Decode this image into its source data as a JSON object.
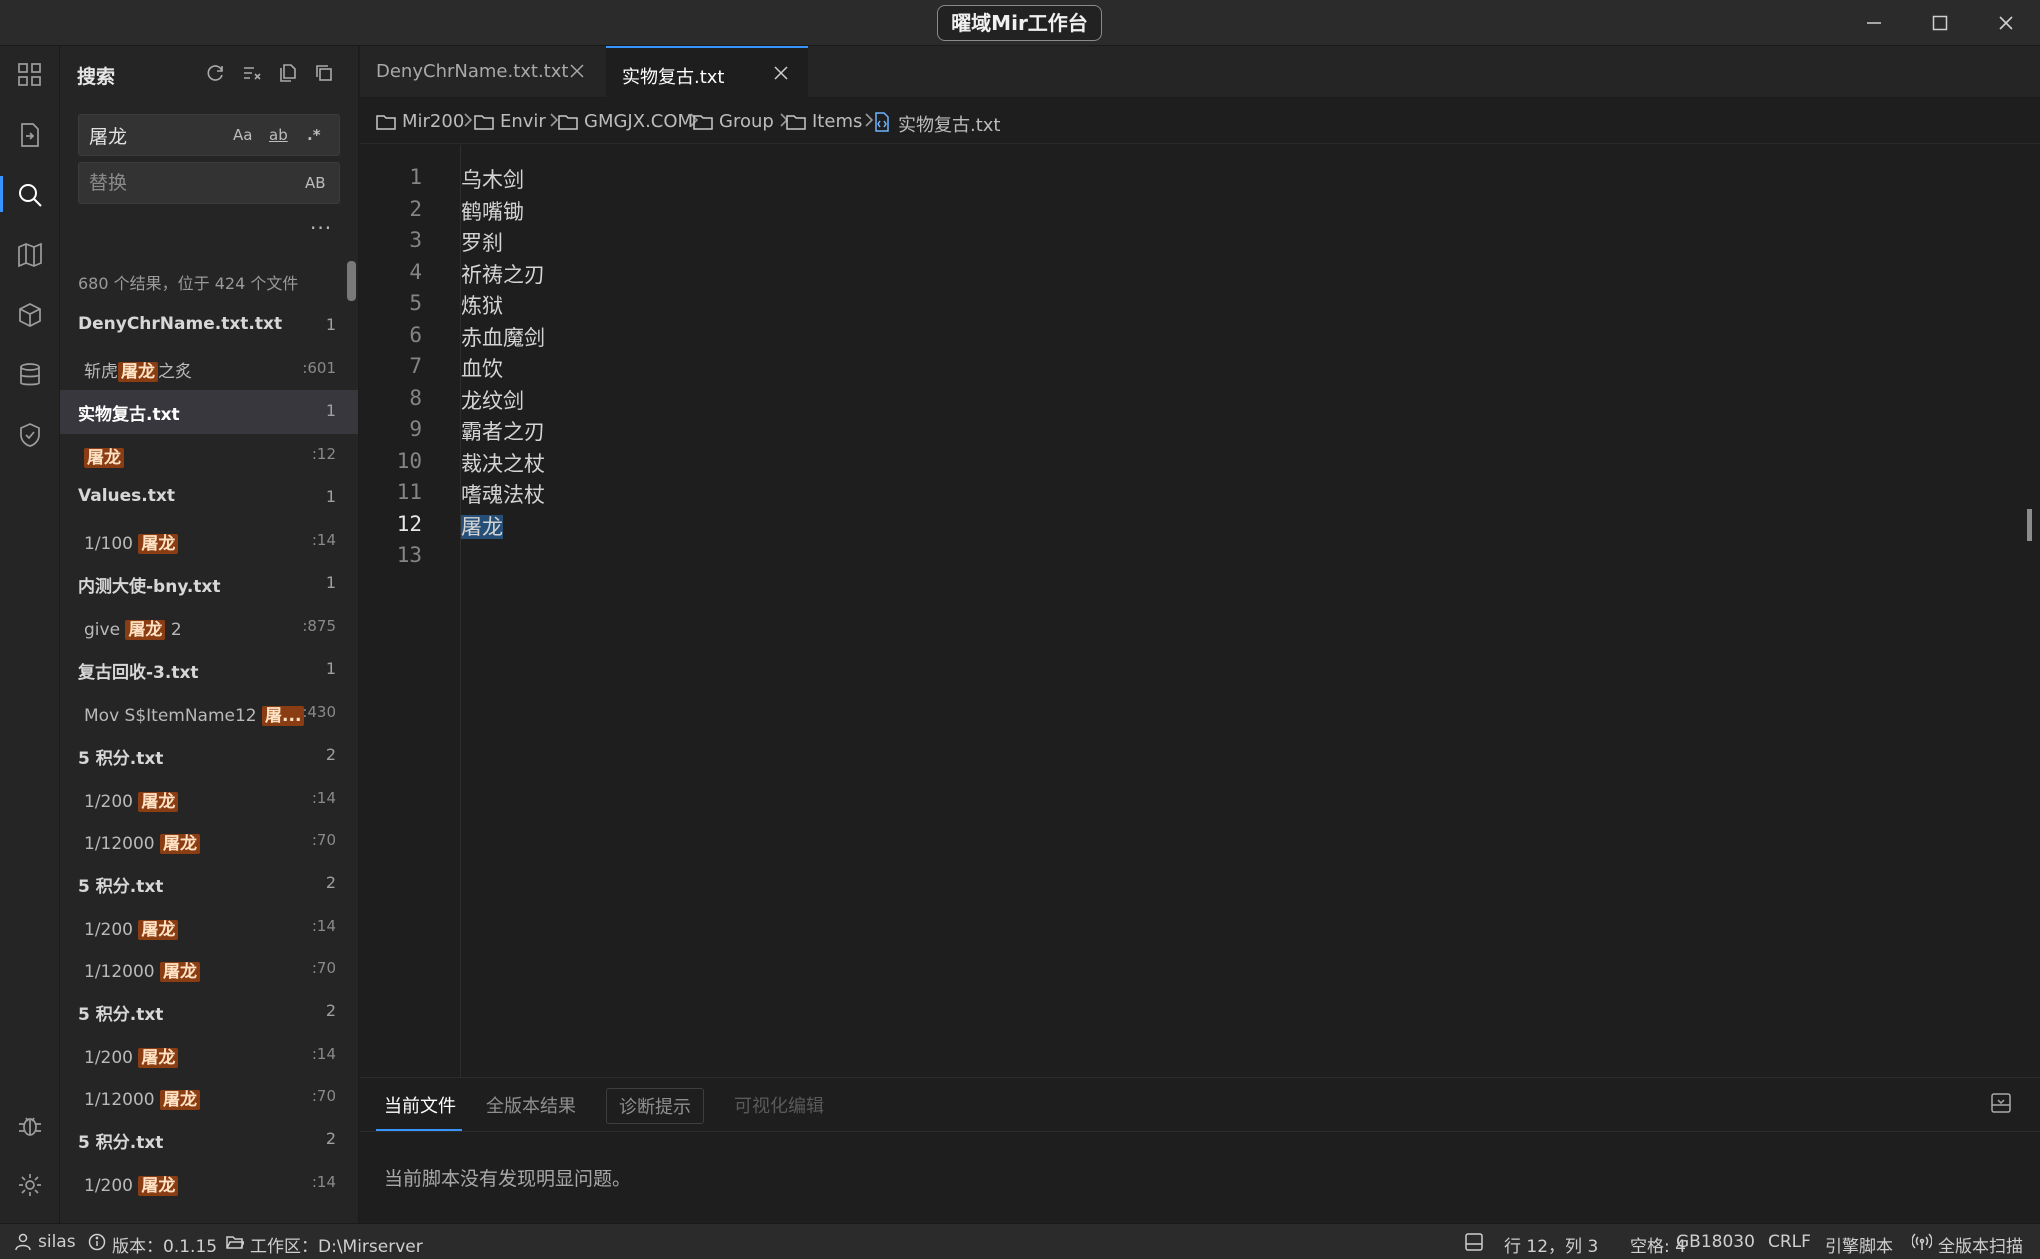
{
  "window": {
    "title": "曜域Mir工作台"
  },
  "sidebar": {
    "title": "搜索",
    "search": {
      "value": "屠龙",
      "placeholder": ""
    },
    "replace": {
      "value": "",
      "placeholder": "替换"
    },
    "search_options": {
      "case": "Aa",
      "word": "ab",
      "regex": ".*"
    },
    "replace_option": "AB",
    "more": "···",
    "summary": "680 个结果，位于 424 个文件",
    "results": [
      {
        "file": "DenyChrName.txt.txt",
        "count": "1",
        "selected": false,
        "matches": [
          {
            "pre": "斩虎",
            "hit": "屠龙",
            "post": "之炙",
            "line": ":601"
          }
        ]
      },
      {
        "file": "实物复古.txt",
        "count": "1",
        "selected": true,
        "matches": [
          {
            "pre": "",
            "hit": "屠龙",
            "post": "",
            "line": ":12"
          }
        ]
      },
      {
        "file": "Values.txt",
        "count": "1",
        "selected": false,
        "matches": [
          {
            "pre": "1/100 ",
            "hit": "屠龙",
            "post": "",
            "line": ":14"
          }
        ]
      },
      {
        "file": "内测大使-bny.txt",
        "count": "1",
        "selected": false,
        "matches": [
          {
            "pre": "give ",
            "hit": "屠龙",
            "post": " 2",
            "line": ":875"
          }
        ]
      },
      {
        "file": "复古回收-3.txt",
        "count": "1",
        "selected": false,
        "matches": [
          {
            "pre": "Mov S$ItemName12 ",
            "hit": "屠...",
            "post": "",
            "line": ":430"
          }
        ]
      },
      {
        "file": "5 积分.txt",
        "count": "2",
        "selected": false,
        "matches": [
          {
            "pre": "1/200 ",
            "hit": "屠龙",
            "post": "",
            "line": ":14"
          },
          {
            "pre": "1/12000 ",
            "hit": "屠龙",
            "post": "",
            "line": ":70"
          }
        ]
      },
      {
        "file": "5 积分.txt",
        "count": "2",
        "selected": false,
        "matches": [
          {
            "pre": "1/200 ",
            "hit": "屠龙",
            "post": "",
            "line": ":14"
          },
          {
            "pre": "1/12000 ",
            "hit": "屠龙",
            "post": "",
            "line": ":70"
          }
        ]
      },
      {
        "file": "5 积分.txt",
        "count": "2",
        "selected": false,
        "matches": [
          {
            "pre": "1/200 ",
            "hit": "屠龙",
            "post": "",
            "line": ":14"
          },
          {
            "pre": "1/12000 ",
            "hit": "屠龙",
            "post": "",
            "line": ":70"
          }
        ]
      },
      {
        "file": "5 积分.txt",
        "count": "2",
        "selected": false,
        "matches": [
          {
            "pre": "1/200 ",
            "hit": "屠龙",
            "post": "",
            "line": ":14"
          }
        ]
      }
    ]
  },
  "tabs": [
    {
      "label": "DenyChrName.txt.txt",
      "active": false
    },
    {
      "label": "实物复古.txt",
      "active": true
    }
  ],
  "breadcrumb": [
    "Mir200",
    "Envir",
    "GMGJX.COM",
    "Group",
    "Items",
    "实物复古.txt"
  ],
  "editor": {
    "current_line": 12,
    "lines": [
      "乌木剑",
      "鹤嘴锄",
      "罗刹",
      "祈祷之刃",
      "炼狱",
      "赤血魔剑",
      "血饮",
      "龙纹剑",
      "霸者之刃",
      "裁决之杖",
      "嗜魂法杖",
      "屠龙",
      ""
    ]
  },
  "panel": {
    "tabs": [
      "当前文件",
      "全版本结果",
      "诊断提示",
      "可视化编辑"
    ],
    "message": "当前脚本没有发现明显问题。"
  },
  "status": {
    "user": "silas",
    "version": "版本：0.1.15",
    "workspace": "工作区：D:\\Mirserver",
    "position": "行 12，列 3",
    "spaces": "空格: 4",
    "encoding": "GB18030",
    "eol": "CRLF",
    "language": "引擎脚本",
    "scan": "全版本扫描"
  },
  "colors": {
    "accent": "#3794ff",
    "highlight": "#8a3d12",
    "selection": "#264f78"
  }
}
